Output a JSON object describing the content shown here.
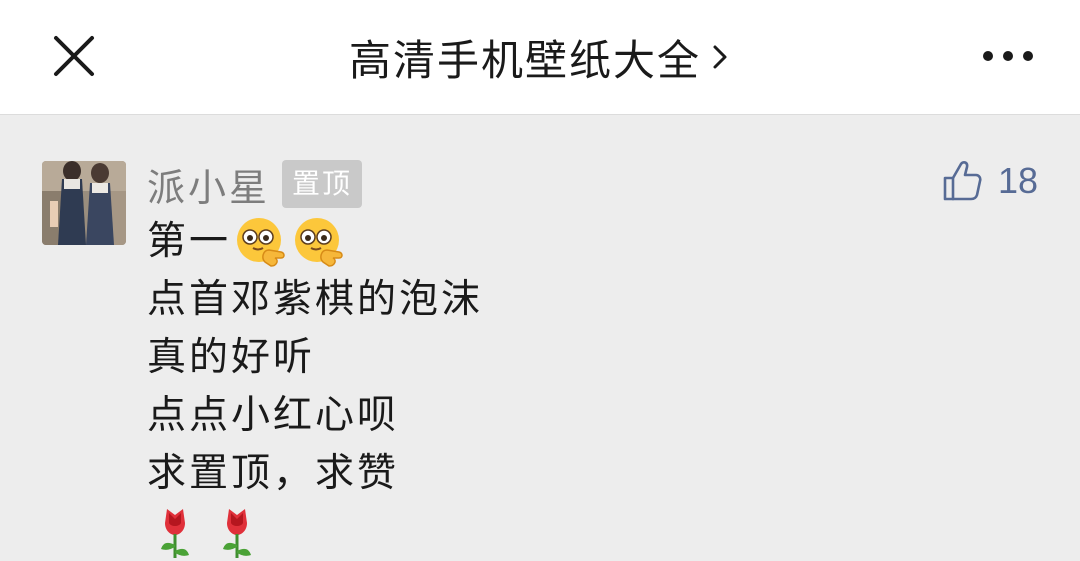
{
  "header": {
    "title": "高清手机壁纸大全",
    "close_icon": "close-icon",
    "chevron_icon": "chevron-right-icon",
    "more_icon": "more-icon"
  },
  "comment": {
    "username": "派小星",
    "badge": "置顶",
    "like_count": "18",
    "like_icon": "thumbs-up-icon",
    "lines": [
      "第一",
      "点首邓紫棋的泡沫",
      "真的好听",
      "点点小红心呗",
      "求置顶，求赞"
    ],
    "emojis": [
      "peeking-face-emoji",
      "peeking-face-emoji"
    ],
    "roses": [
      "rose-emoji",
      "rose-emoji"
    ]
  },
  "colors": {
    "header_bg": "#ffffff",
    "page_bg": "#ededed",
    "username": "#7d7d7d",
    "badge_bg": "#c9c9c9",
    "like_accent": "#576b95",
    "text": "#1a1a1a"
  }
}
